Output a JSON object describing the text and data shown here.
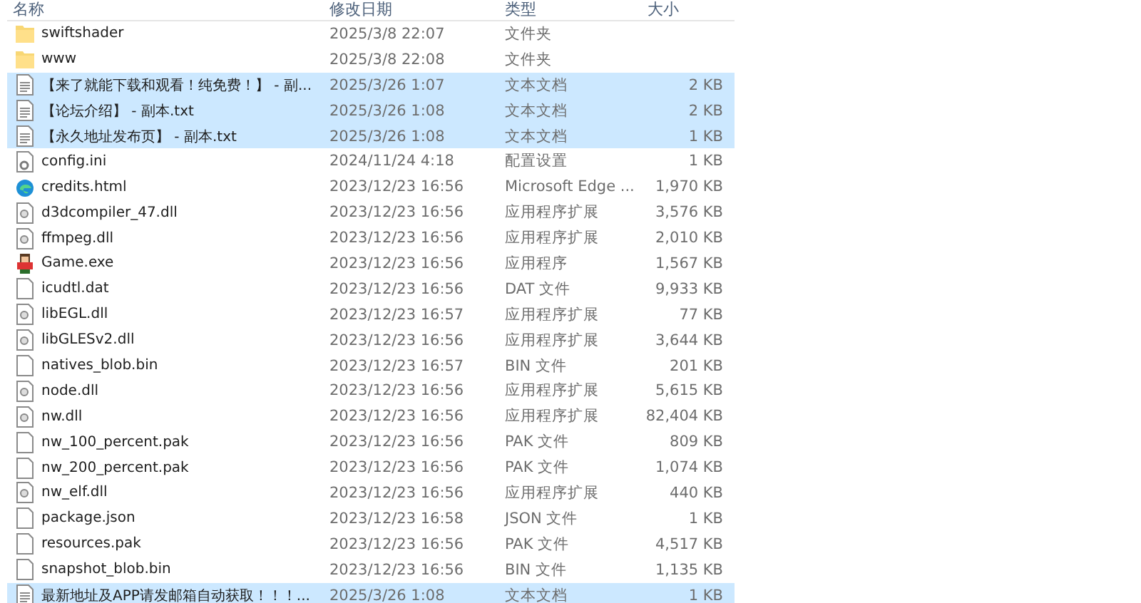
{
  "header": {
    "columns": [
      "名称",
      "修改日期",
      "类型",
      "大小"
    ]
  },
  "files": [
    {
      "name": "swiftshader",
      "date": "2025/3/8 22:07",
      "type": "文件夹",
      "kind": "folder",
      "selected": false
    },
    {
      "name": "www",
      "date": "2025/3/8 22:08",
      "type": "文件夹",
      "kind": "folder",
      "selected": false
    },
    {
      "name": "【来了就能下载和观看！纯免费！】 - 副...",
      "date": "2025/3/26 1:07",
      "type": "文本文档",
      "size": "2 KB",
      "kind": "text",
      "selected": true
    },
    {
      "name": "【论坛介绍】 - 副本.txt",
      "date": "2025/3/26 1:08",
      "type": "文本文档",
      "size": "2 KB",
      "kind": "text",
      "selected": true
    },
    {
      "name": "【永久地址发布页】 - 副本.txt",
      "date": "2025/3/26 1:08",
      "type": "文本文档",
      "size": "1 KB",
      "kind": "text",
      "selected": true
    },
    {
      "name": "config.ini",
      "date": "2024/11/24 4:18",
      "type": "配置设置",
      "size": "1 KB",
      "kind": "settings",
      "selected": false
    },
    {
      "name": "credits.html",
      "date": "2023/12/23 16:56",
      "type": "Microsoft Edge ...",
      "size": "1,970 KB",
      "kind": "browser",
      "selected": false
    },
    {
      "name": "d3dcompiler_47.dll",
      "date": "2023/12/23 16:56",
      "type": "应用程序扩展",
      "size": "3,576 KB",
      "kind": "library",
      "selected": false
    },
    {
      "name": "ffmpeg.dll",
      "date": "2023/12/23 16:56",
      "type": "应用程序扩展",
      "size": "2,010 KB",
      "kind": "library",
      "selected": false
    },
    {
      "name": "Game.exe",
      "date": "2023/12/23 16:56",
      "type": "应用程序",
      "size": "1,567 KB",
      "kind": "app",
      "selected": false
    },
    {
      "name": "icudtl.dat",
      "date": "2023/12/23 16:56",
      "type": "DAT 文件",
      "size": "9,933 KB",
      "kind": "blank",
      "selected": false
    },
    {
      "name": "libEGL.dll",
      "date": "2023/12/23 16:57",
      "type": "应用程序扩展",
      "size": "77 KB",
      "kind": "library",
      "selected": false
    },
    {
      "name": "libGLESv2.dll",
      "date": "2023/12/23 16:56",
      "type": "应用程序扩展",
      "size": "3,644 KB",
      "kind": "library",
      "selected": false
    },
    {
      "name": "natives_blob.bin",
      "date": "2023/12/23 16:57",
      "type": "BIN 文件",
      "size": "201 KB",
      "kind": "blank",
      "selected": false
    },
    {
      "name": "node.dll",
      "date": "2023/12/23 16:56",
      "type": "应用程序扩展",
      "size": "5,615 KB",
      "kind": "library",
      "selected": false
    },
    {
      "name": "nw.dll",
      "date": "2023/12/23 16:56",
      "type": "应用程序扩展",
      "size": "82,404 KB",
      "kind": "library",
      "selected": false
    },
    {
      "name": "nw_100_percent.pak",
      "date": "2023/12/23 16:56",
      "type": "PAK 文件",
      "size": "809 KB",
      "kind": "blank",
      "selected": false
    },
    {
      "name": "nw_200_percent.pak",
      "date": "2023/12/23 16:56",
      "type": "PAK 文件",
      "size": "1,074 KB",
      "kind": "blank",
      "selected": false
    },
    {
      "name": "nw_elf.dll",
      "date": "2023/12/23 16:56",
      "type": "应用程序扩展",
      "size": "440 KB",
      "kind": "library",
      "selected": false
    },
    {
      "name": "package.json",
      "date": "2023/12/23 16:58",
      "type": "JSON 文件",
      "size": "1 KB",
      "kind": "blank",
      "selected": false
    },
    {
      "name": "resources.pak",
      "date": "2023/12/23 16:56",
      "type": "PAK 文件",
      "size": "4,517 KB",
      "kind": "blank",
      "selected": false
    },
    {
      "name": "snapshot_blob.bin",
      "date": "2023/12/23 16:56",
      "type": "BIN 文件",
      "size": "1,135 KB",
      "kind": "blank",
      "selected": false
    },
    {
      "name": "最新地址及APP请发邮箱自动获取！！！...",
      "date": "2025/3/26 1:08",
      "type": "文本文档",
      "size": "1 KB",
      "kind": "text",
      "selected": true
    }
  ]
}
